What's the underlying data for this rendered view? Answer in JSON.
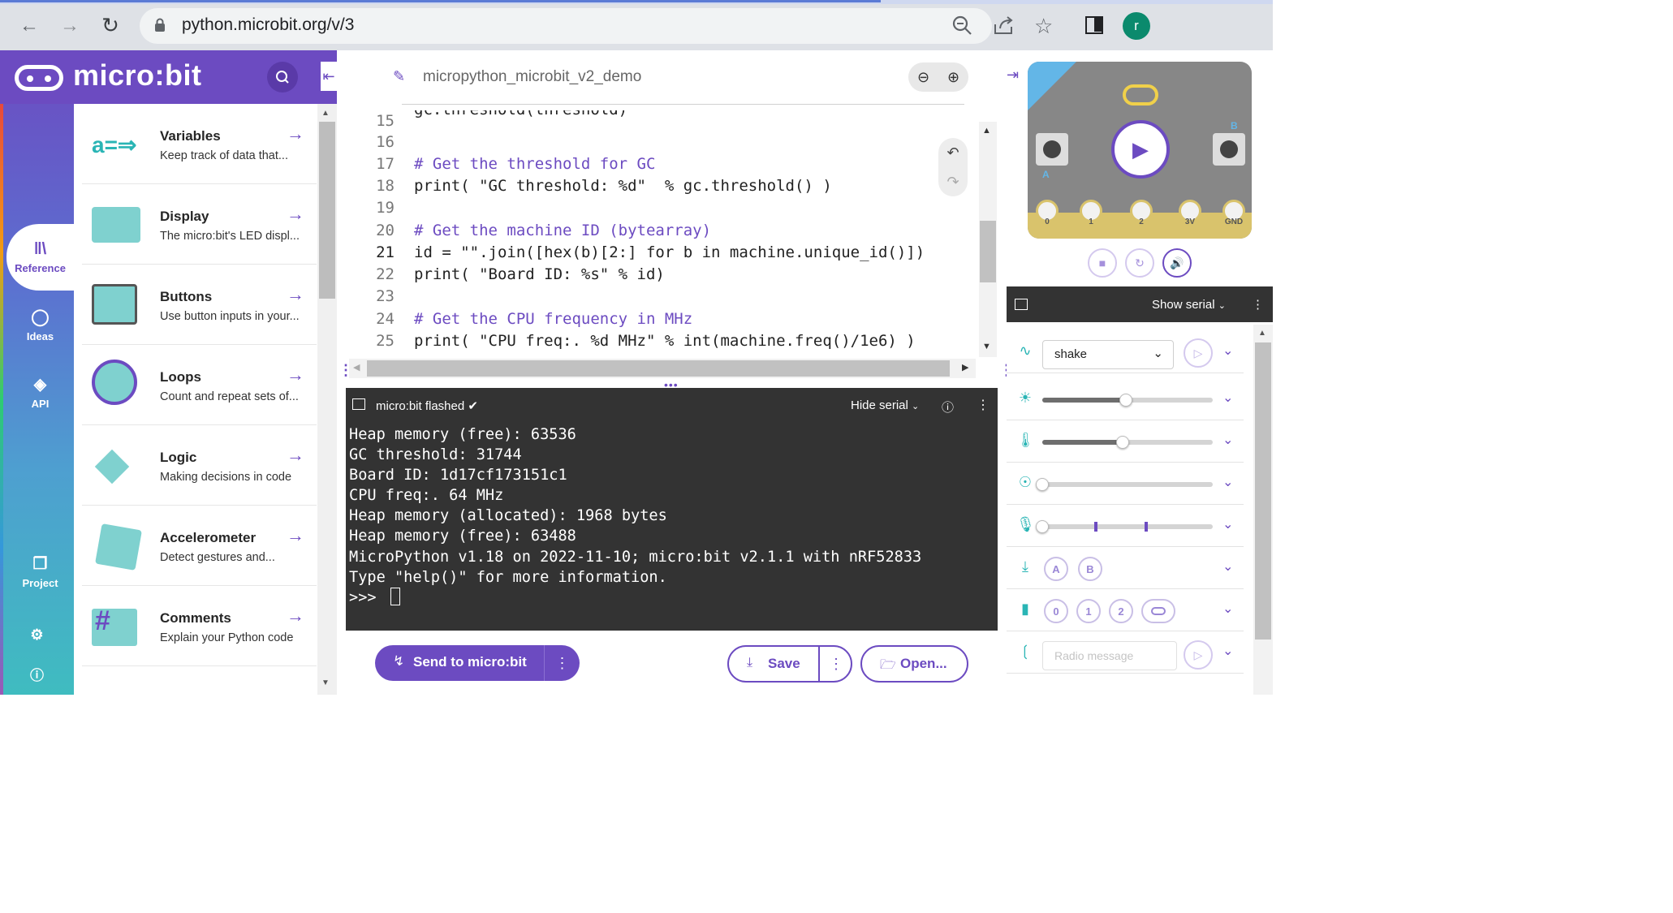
{
  "browser": {
    "url": "python.microbit.org/v/3",
    "avatar_letter": "r"
  },
  "app": {
    "logo_text": "micro:bit",
    "project_name": "micropython_microbit_v2_demo"
  },
  "rail": {
    "items": [
      {
        "label": "Reference"
      },
      {
        "label": "Ideas"
      },
      {
        "label": "API"
      },
      {
        "label": "Project"
      }
    ]
  },
  "reference": {
    "items": [
      {
        "title": "Variables",
        "desc": "Keep track of data that..."
      },
      {
        "title": "Display",
        "desc": "The micro:bit's LED displ..."
      },
      {
        "title": "Buttons",
        "desc": "Use button inputs in your..."
      },
      {
        "title": "Loops",
        "desc": "Count and repeat sets of..."
      },
      {
        "title": "Logic",
        "desc": "Making decisions in code"
      },
      {
        "title": "Accelerometer",
        "desc": "Detect gestures and..."
      },
      {
        "title": "Comments",
        "desc": "Explain your Python code"
      }
    ]
  },
  "code": {
    "lines": [
      {
        "n": "15",
        "text": "gc.threshold(threshold)"
      },
      {
        "n": "16",
        "text": ""
      },
      {
        "n": "17",
        "text": "# Get the threshold for GC"
      },
      {
        "n": "18",
        "text": "print( \"GC threshold: %d\"  % gc.threshold() )"
      },
      {
        "n": "19",
        "text": ""
      },
      {
        "n": "20",
        "text": "# Get the machine ID (bytearray)"
      },
      {
        "n": "21",
        "text": "id = \"\".join([hex(b)[2:] for b in machine.unique_id()])"
      },
      {
        "n": "22",
        "text": "print( \"Board ID: %s\" % id)"
      },
      {
        "n": "23",
        "text": ""
      },
      {
        "n": "24",
        "text": "# Get the CPU frequency in MHz"
      },
      {
        "n": "25",
        "text": "print( \"CPU freq:. %d MHz\" % int(machine.freq()/1e6) )"
      }
    ],
    "current_line": "21"
  },
  "serial": {
    "title": "micro:bit flashed",
    "hide_label": "Hide serial",
    "output": [
      "Heap memory (free): 63536",
      "GC threshold: 31744",
      "Board ID: 1d17cf173151c1",
      "CPU freq:. 64 MHz",
      "Heap memory (allocated): 1968 bytes",
      "Heap memory (free): 63488",
      "MicroPython v1.18 on 2022-11-10; micro:bit v2.1.1 with nRF52833",
      "Type \"help()\" for more information.",
      ">>> "
    ]
  },
  "actions": {
    "send_label": "Send to micro:bit",
    "save_label": "Save",
    "open_label": "Open..."
  },
  "simulator": {
    "pins": [
      "0",
      "1",
      "2",
      "3V",
      "GND"
    ],
    "button_a": "A",
    "button_b": "B",
    "show_serial_label": "Show serial",
    "gesture": "shake",
    "light_level": 0.49,
    "temperature_level": 0.47,
    "compass_level": 0.0,
    "sound_level": 0.0,
    "buttons": [
      "A",
      "B"
    ],
    "pin_buttons": [
      "0",
      "1",
      "2"
    ],
    "radio_placeholder": "Radio message"
  },
  "colors": {
    "brand": "#6c4bc1",
    "sensor_icon": "#2ab5b5",
    "serial_bg": "#333333"
  }
}
